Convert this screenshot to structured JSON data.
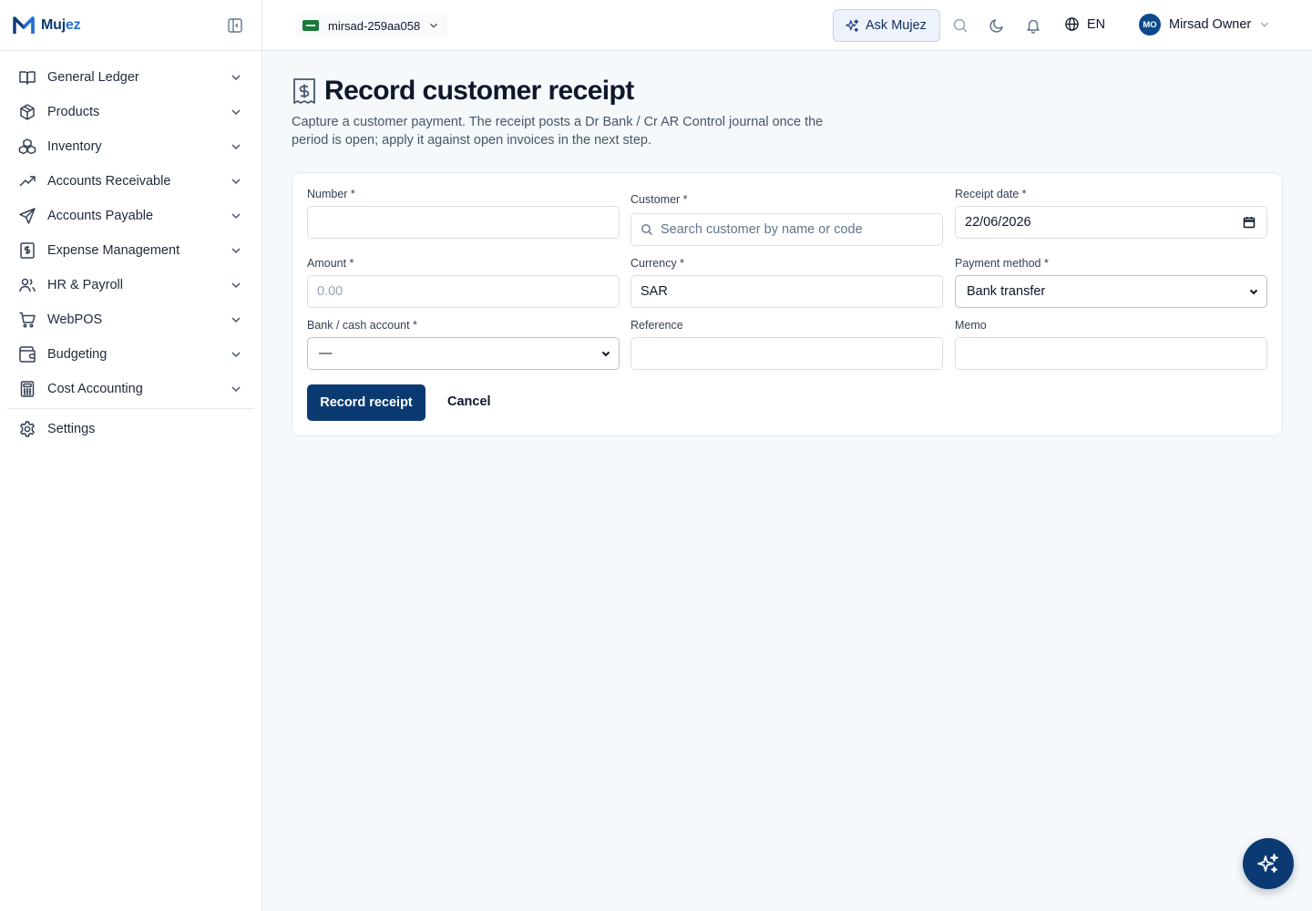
{
  "brand": {
    "name_part1": "Muj",
    "name_part2": "ez"
  },
  "sidebar": {
    "items": [
      {
        "label": "General Ledger",
        "icon": "book-open-icon"
      },
      {
        "label": "Products",
        "icon": "box-icon"
      },
      {
        "label": "Inventory",
        "icon": "boxes-icon"
      },
      {
        "label": "Accounts Receivable",
        "icon": "trending-up-icon"
      },
      {
        "label": "Accounts Payable",
        "icon": "send-icon"
      },
      {
        "label": "Expense Management",
        "icon": "receipt-icon"
      },
      {
        "label": "HR & Payroll",
        "icon": "users-icon"
      },
      {
        "label": "WebPOS",
        "icon": "cart-icon"
      },
      {
        "label": "Budgeting",
        "icon": "wallet-icon"
      },
      {
        "label": "Cost Accounting",
        "icon": "calculator-icon"
      }
    ],
    "settings_label": "Settings"
  },
  "header": {
    "tenant": "mirsad-259aa058",
    "ask_label": "Ask Mujez",
    "language": "EN",
    "user_initials": "MO",
    "user_name": "Mirsad Owner"
  },
  "page": {
    "title": "Record customer receipt",
    "subtitle": "Capture a customer payment. The receipt posts a Dr Bank / Cr AR Control journal once the period is open; apply it against open invoices in the next step."
  },
  "form": {
    "number": {
      "label": "Number *",
      "value": ""
    },
    "customer": {
      "label": "Customer *",
      "placeholder": "Search customer by name or code"
    },
    "receipt_date": {
      "label": "Receipt date *",
      "value": "22/06/2026"
    },
    "amount": {
      "label": "Amount *",
      "placeholder": "0.00"
    },
    "currency": {
      "label": "Currency *",
      "value": "SAR"
    },
    "payment_method": {
      "label": "Payment method *",
      "value": "Bank transfer"
    },
    "bank_account": {
      "label": "Bank / cash account *",
      "value": "—"
    },
    "reference": {
      "label": "Reference",
      "value": ""
    },
    "memo": {
      "label": "Memo",
      "value": ""
    },
    "submit_label": "Record receipt",
    "cancel_label": "Cancel"
  },
  "colors": {
    "primary": "#0b3a73",
    "accent": "#1e6fd9",
    "background": "#f6f9fc"
  }
}
